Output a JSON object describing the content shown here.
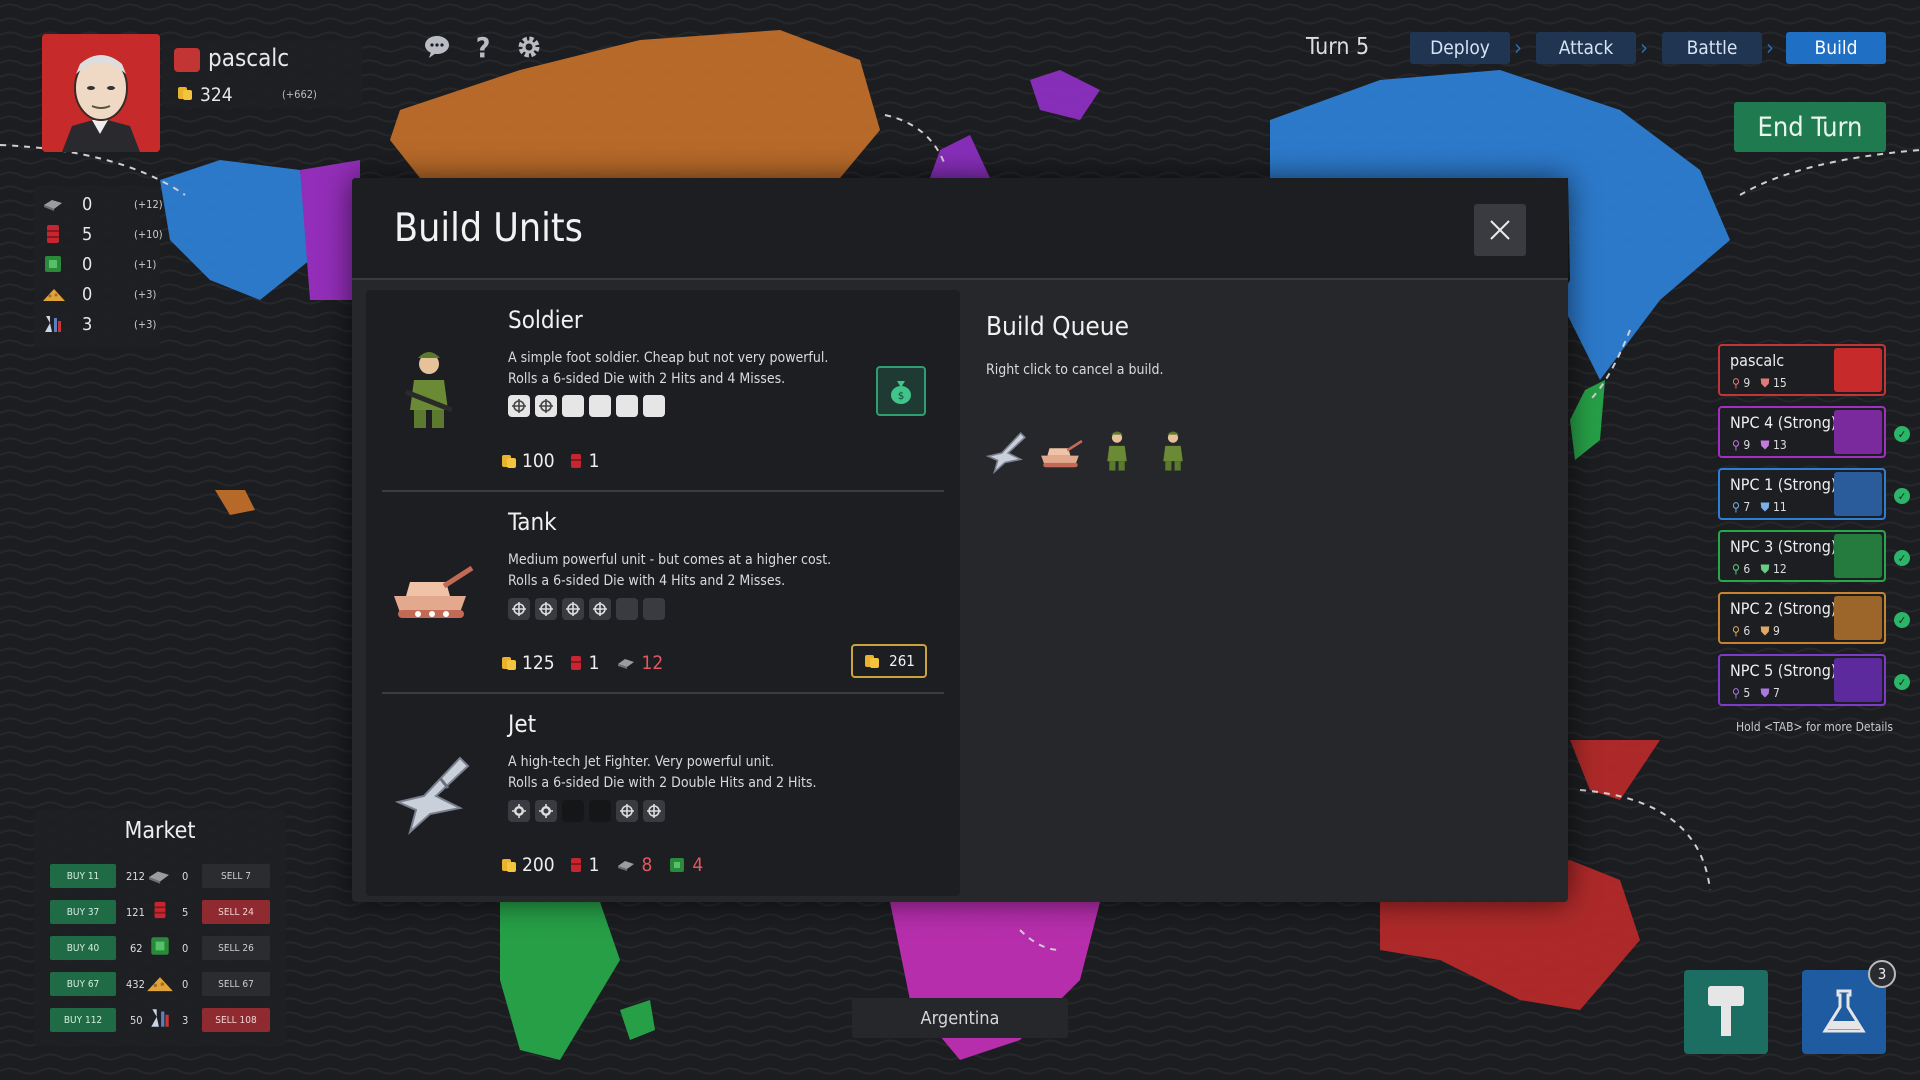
{
  "player": {
    "name": "pascalc",
    "gold": "324",
    "income": "(+662)",
    "color": "#c33535"
  },
  "resources": [
    {
      "icon": "steel-icon",
      "value": "0",
      "income": "(+12)"
    },
    {
      "icon": "oil-barrel-icon",
      "value": "5",
      "income": "(+10)"
    },
    {
      "icon": "microchip-icon",
      "value": "0",
      "income": "(+1)"
    },
    {
      "icon": "grain-icon",
      "value": "0",
      "income": "(+3)"
    },
    {
      "icon": "flask-icon",
      "value": "3",
      "income": "(+3)"
    }
  ],
  "top_icons": [
    "chat-icon",
    "help-icon",
    "settings-icon"
  ],
  "turn": "Turn 5",
  "phases": [
    {
      "label": "Deploy",
      "active": false
    },
    {
      "label": "Attack",
      "active": false
    },
    {
      "label": "Battle",
      "active": false
    },
    {
      "label": "Build",
      "active": true
    }
  ],
  "end_turn": "End Turn",
  "modal": {
    "title": "Build Units",
    "units": [
      {
        "name": "Soldier",
        "line1": "A simple foot soldier. Cheap but not very powerful.",
        "line2": "Rolls a 6-sided Die with 2 Hits and 4 Misses.",
        "gold": "100",
        "oil": "1"
      },
      {
        "name": "Tank",
        "line1": "Medium powerful unit - but comes at a higher cost.",
        "line2": "Rolls a 6-sided Die with 4 Hits and 2 Misses.",
        "gold": "125",
        "oil": "1",
        "steel": "12",
        "badge_gold": "261"
      },
      {
        "name": "Jet",
        "line1": "A high-tech Jet Fighter. Very powerful unit.",
        "line2": "Rolls a 6-sided Die with 2 Double Hits and 2 Hits.",
        "gold": "200",
        "oil": "1",
        "steel": "8",
        "chip": "4"
      }
    ],
    "queue": {
      "title": "Build Queue",
      "hint": "Right click to cancel a build.",
      "items": [
        "jet-icon",
        "tank-icon",
        "soldier-icon",
        "soldier-icon"
      ]
    }
  },
  "players": [
    {
      "name": "pascalc",
      "territories": "9",
      "units": "15",
      "color": "#c33535"
    },
    {
      "name": "NPC 4 (Strong)",
      "territories": "9",
      "units": "13",
      "color": "#a12fc2"
    },
    {
      "name": "NPC 1 (Strong)",
      "territories": "7",
      "units": "11",
      "color": "#2d7ed4"
    },
    {
      "name": "NPC 3 (Strong)",
      "territories": "6",
      "units": "12",
      "color": "#27a64a"
    },
    {
      "name": "NPC 2 (Strong)",
      "territories": "6",
      "units": "9",
      "color": "#c9832f"
    },
    {
      "name": "NPC 5 (Strong)",
      "territories": "5",
      "units": "7",
      "color": "#7d3bc9"
    }
  ],
  "tab_hint": "Hold <TAB> for more Details",
  "market": {
    "title": "Market",
    "rows": [
      {
        "buy": "BUY 11",
        "price": "212",
        "icon": "steel-icon",
        "owned": "0",
        "sell": "SELL 7",
        "hot": false
      },
      {
        "buy": "BUY 37",
        "price": "121",
        "icon": "oil-barrel-icon",
        "owned": "5",
        "sell": "SELL 24",
        "hot": true
      },
      {
        "buy": "BUY 40",
        "price": "62",
        "icon": "microchip-icon",
        "owned": "0",
        "sell": "SELL 26",
        "hot": false
      },
      {
        "buy": "BUY 67",
        "price": "432",
        "icon": "grain-icon",
        "owned": "0",
        "sell": "SELL 67",
        "hot": false
      },
      {
        "buy": "BUY 112",
        "price": "50",
        "icon": "flask-icon",
        "owned": "3",
        "sell": "SELL 108",
        "hot": true
      }
    ]
  },
  "territory_label": "Argentina",
  "research_badge": "3",
  "colors": {
    "accent": "#1f6fc4",
    "build_green": "#1f7a4f"
  }
}
